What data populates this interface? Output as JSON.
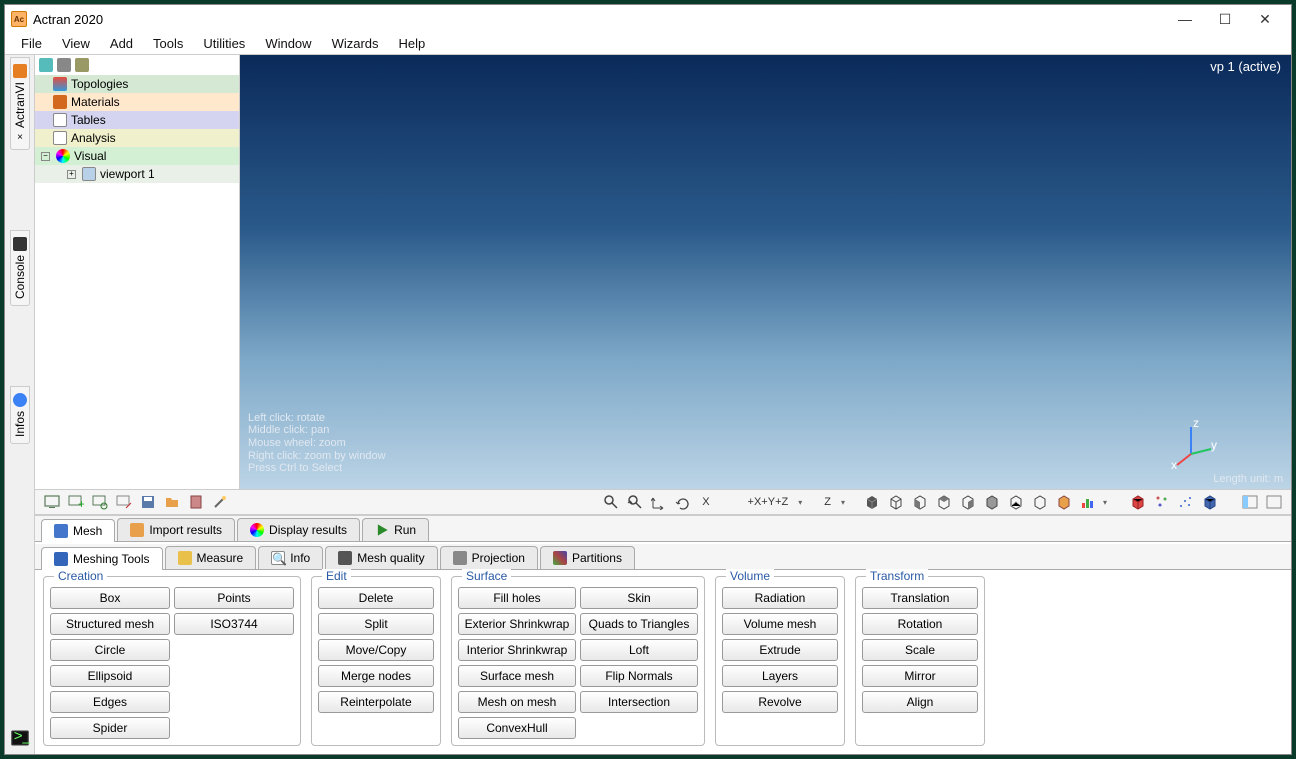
{
  "window": {
    "title": "Actran 2020"
  },
  "menu": [
    "File",
    "View",
    "Add",
    "Tools",
    "Utilities",
    "Window",
    "Wizards",
    "Help"
  ],
  "side_tabs": {
    "t0": "ActranVI",
    "t1": "Console",
    "t2": "Infos"
  },
  "tree": {
    "topologies": "Topologies",
    "materials": "Materials",
    "tables": "Tables",
    "analysis": "Analysis",
    "visual": "Visual",
    "viewport": "viewport 1"
  },
  "viewport": {
    "label": "vp 1 (active)",
    "hints": "Left click: rotate\nMiddle click: pan\nMouse wheel: zoom\nRight click: zoom by window\nPress Ctrl to Select",
    "unit": "Length unit: m"
  },
  "toolbar": {
    "x": "X",
    "xyz": "+X+Y+Z",
    "z": "Z"
  },
  "tabs1": {
    "mesh": "Mesh",
    "import": "Import results",
    "display": "Display results",
    "run": "Run"
  },
  "tabs2": {
    "meshing": "Meshing Tools",
    "measure": "Measure",
    "info": "Info",
    "quality": "Mesh quality",
    "projection": "Projection",
    "partitions": "Partitions"
  },
  "groups": {
    "creation": {
      "legend": "Creation",
      "box": "Box",
      "points": "Points",
      "struct": "Structured mesh",
      "iso": "ISO3744",
      "circle": "Circle",
      "ellipsoid": "Ellipsoid",
      "edges": "Edges",
      "spider": "Spider"
    },
    "edit": {
      "legend": "Edit",
      "delete": "Delete",
      "split": "Split",
      "move": "Move/Copy",
      "merge": "Merge nodes",
      "reint": "Reinterpolate"
    },
    "surface": {
      "legend": "Surface",
      "fill": "Fill holes",
      "skin": "Skin",
      "ext": "Exterior Shrinkwrap",
      "quads": "Quads to Triangles",
      "int": "Interior Shrinkwrap",
      "loft": "Loft",
      "smesh": "Surface mesh",
      "flip": "Flip Normals",
      "mom": "Mesh on mesh",
      "inter": "Intersection",
      "hull": "ConvexHull"
    },
    "volume": {
      "legend": "Volume",
      "rad": "Radiation",
      "vmesh": "Volume mesh",
      "extrude": "Extrude",
      "layers": "Layers",
      "revolve": "Revolve"
    },
    "transform": {
      "legend": "Transform",
      "trans": "Translation",
      "rot": "Rotation",
      "scale": "Scale",
      "mirror": "Mirror",
      "align": "Align"
    }
  }
}
